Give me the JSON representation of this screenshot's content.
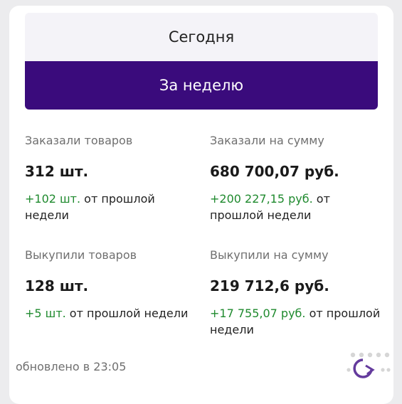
{
  "tabs": {
    "today": "Сегодня",
    "week": "За неделю"
  },
  "metrics": {
    "ordered_items": {
      "label": "Заказали товаров",
      "value": "312 шт.",
      "delta": "+102 шт.",
      "delta_suffix": " от прошлой недели"
    },
    "ordered_sum": {
      "label": "Заказали на сумму",
      "value": "680 700,07 руб.",
      "delta": "+200 227,15 руб.",
      "delta_suffix": " от прошлой недели"
    },
    "bought_items": {
      "label": "Выкупили товаров",
      "value": "128 шт.",
      "delta": "+5 шт.",
      "delta_suffix": " от прошлой недели"
    },
    "bought_sum": {
      "label": "Выкупили на сумму",
      "value": "219 712,6 руб.",
      "delta": "+17 755,07 руб.",
      "delta_suffix": " от прошлой недели"
    }
  },
  "footer": {
    "updated": "обновлено в 23:05"
  },
  "colors": {
    "accent": "#3a0b7c",
    "positive": "#1f8a2e"
  }
}
